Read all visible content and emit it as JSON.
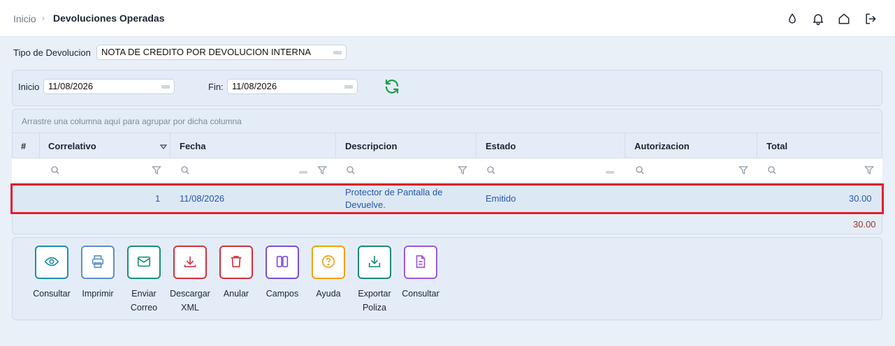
{
  "breadcrumb": {
    "home": "Inicio",
    "separator": "›",
    "current": "Devoluciones Operadas"
  },
  "topbar_icons": [
    "drop-icon",
    "bell-icon",
    "home-icon",
    "logout-icon"
  ],
  "tipo": {
    "label": "Tipo de Devolucion",
    "value": "NOTA DE CREDITO POR DEVOLUCION INTERNA"
  },
  "dates": {
    "inicio_label": "Inicio",
    "inicio_value": "11/08/2026",
    "fin_label": "Fin:",
    "fin_value": "11/08/2026"
  },
  "grid": {
    "group_hint": "Arrastre una columna aquí para agrupar por dicha columna",
    "columns": [
      "#",
      "Correlativo",
      "Fecha",
      "Descripcion",
      "Estado",
      "Autorizacion",
      "Total"
    ],
    "rows": [
      {
        "num": "",
        "correlativo": "1",
        "fecha": "11/08/2026",
        "descripcion_1": "Protector de Pantalla de",
        "descripcion_2": "Devuelve.",
        "estado": "Emitido",
        "autorizacion": "",
        "total": "30.00"
      }
    ],
    "footer_total": "30.00"
  },
  "actions": [
    {
      "label_1": "Consultar",
      "label_2": "",
      "icon": "eye-icon",
      "color": "#1f8fa6"
    },
    {
      "label_1": "Imprimir",
      "label_2": "",
      "icon": "printer-icon",
      "color": "#5f8fc4"
    },
    {
      "label_1": "Enviar",
      "label_2": "Correo",
      "icon": "mail-icon",
      "color": "#16917a"
    },
    {
      "label_1": "Descargar",
      "label_2": "XML",
      "icon": "download-icon",
      "color": "#d2313f"
    },
    {
      "label_1": "Anular",
      "label_2": "",
      "icon": "trash-icon",
      "color": "#d2313f"
    },
    {
      "label_1": "Campos",
      "label_2": "",
      "icon": "columns-icon",
      "color": "#7c4ddc"
    },
    {
      "label_1": "Ayuda",
      "label_2": "",
      "icon": "help-icon",
      "color": "#f0a10a"
    },
    {
      "label_1": "Exportar",
      "label_2": "Poliza",
      "icon": "export-icon",
      "color": "#1a8a7a"
    },
    {
      "label_1": "Consultar",
      "label_2": "",
      "icon": "document-icon",
      "color": "#9b59d8"
    }
  ],
  "colors": {
    "accent": "#2458a8",
    "highlight": "#e0212a",
    "refresh": "#1e9e4a"
  }
}
